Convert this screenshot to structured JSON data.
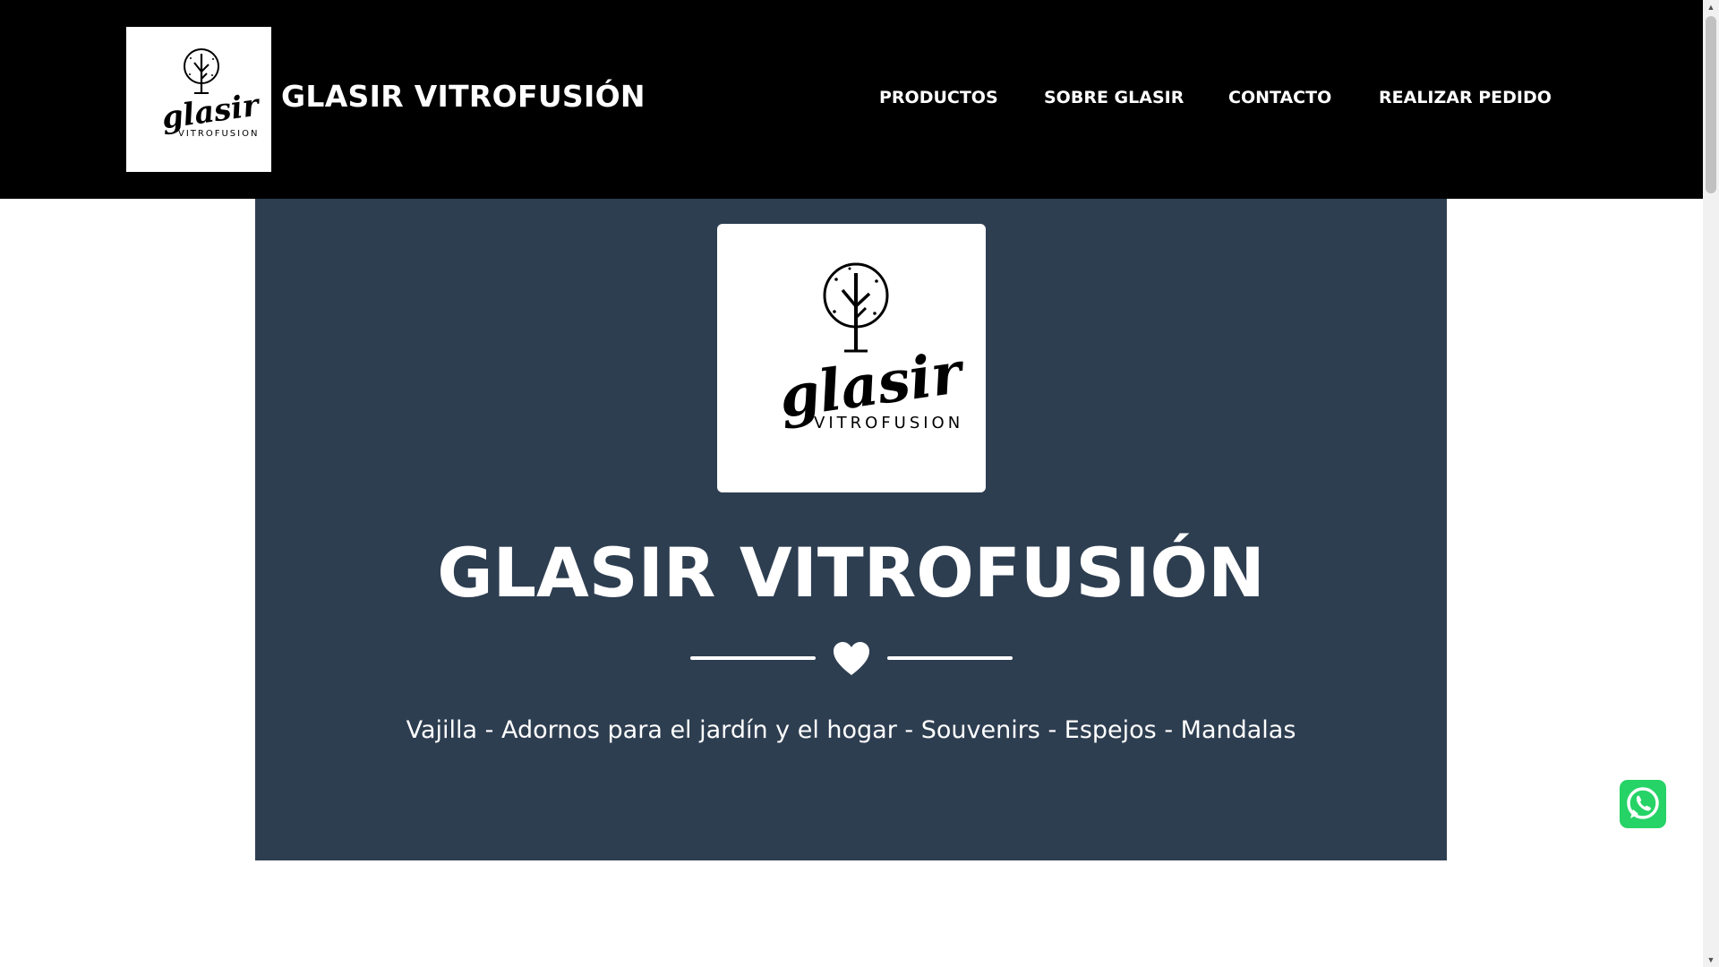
{
  "header": {
    "brand_title": "GLASIR VITROFUSIÓN",
    "logo": {
      "script_text": "glasir",
      "sub_text": "VITROFUSION"
    },
    "nav": [
      {
        "label": "PRODUCTOS"
      },
      {
        "label": "SOBRE GLASIR"
      },
      {
        "label": "CONTACTO"
      },
      {
        "label": "REALIZAR PEDIDO"
      }
    ]
  },
  "hero": {
    "title": "GLASIR VITROFUSIÓN",
    "subtitle": "Vajilla - Adornos para el jardín y el hogar - Souvenirs - Espejos - Mandalas",
    "divider_icon": "heart-icon"
  },
  "floating": {
    "whatsapp_icon": "whatsapp-icon"
  },
  "colors": {
    "navbar_bg": "#000000",
    "hero_bg": "#2e3e51",
    "text_light": "#ffffff",
    "whatsapp_green": "#25d366"
  }
}
